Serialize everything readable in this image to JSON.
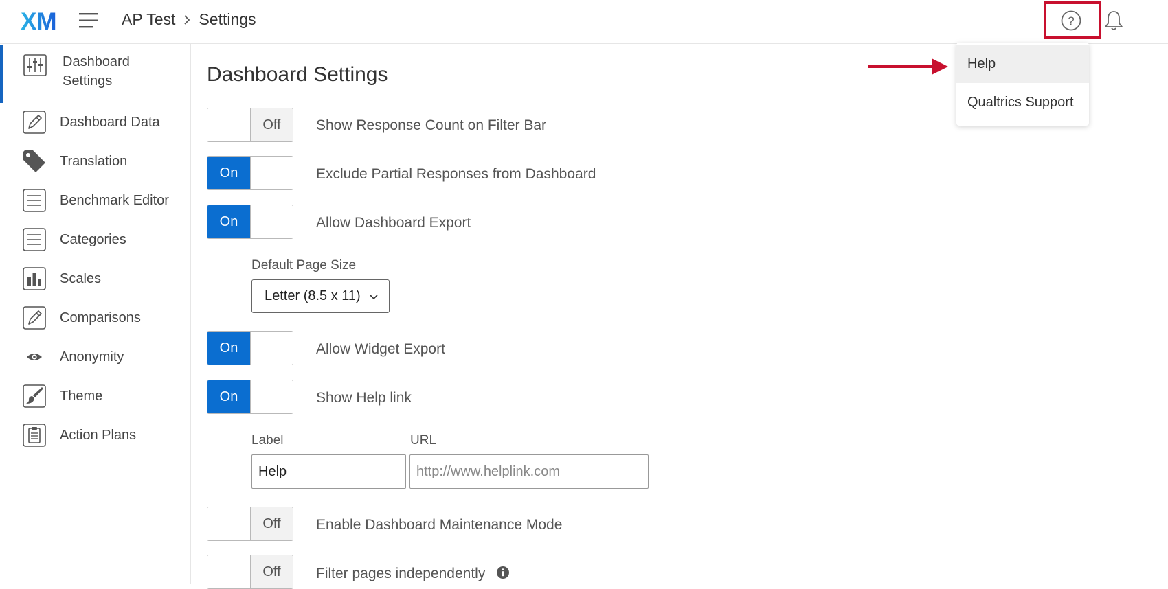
{
  "header": {
    "logo_text": "XM",
    "breadcrumb": {
      "project": "AP Test",
      "page": "Settings"
    },
    "icons": {
      "menu": "hamburger-icon",
      "help": "help-circle-icon",
      "notifications": "bell-icon"
    },
    "highlight_color": "#c8102e"
  },
  "sidebar": {
    "items": [
      {
        "label": "Dashboard Settings",
        "icon": "sliders-icon",
        "active": true
      },
      {
        "label": "Dashboard Data",
        "icon": "pencil-icon"
      },
      {
        "label": "Translation",
        "icon": "tag-icon"
      },
      {
        "label": "Benchmark Editor",
        "icon": "list-icon"
      },
      {
        "label": "Categories",
        "icon": "list-icon"
      },
      {
        "label": "Scales",
        "icon": "bar-chart-icon"
      },
      {
        "label": "Comparisons",
        "icon": "pencil-icon"
      },
      {
        "label": "Anonymity",
        "icon": "eye-icon"
      },
      {
        "label": "Theme",
        "icon": "paintbrush-icon"
      },
      {
        "label": "Action Plans",
        "icon": "clipboard-icon"
      }
    ],
    "accent_color": "#1565c0"
  },
  "main": {
    "title": "Dashboard Settings",
    "toggle_on_color": "#0b6ed0",
    "options": [
      {
        "label": "Show Response Count on Filter Bar",
        "state": "Off"
      },
      {
        "label": "Exclude Partial Responses from Dashboard",
        "state": "On"
      },
      {
        "label": "Allow Dashboard Export",
        "state": "On"
      },
      {
        "label": "Allow Widget Export",
        "state": "On"
      },
      {
        "label": "Show Help link",
        "state": "On"
      },
      {
        "label": "Enable Dashboard Maintenance Mode",
        "state": "Off"
      },
      {
        "label": "Filter pages independently",
        "state": "Off",
        "icon": "info-icon"
      }
    ],
    "page_size": {
      "label": "Default Page Size",
      "value": "Letter (8.5 x 11)"
    },
    "help_link": {
      "label_field": {
        "label": "Label",
        "value": "Help"
      },
      "url_field": {
        "label": "URL",
        "placeholder": "http://www.helplink.com"
      }
    }
  },
  "help_menu": {
    "items": [
      {
        "label": "Help",
        "highlighted": true
      },
      {
        "label": "Qualtrics Support"
      }
    ],
    "pointer": "arrow-right-icon"
  }
}
